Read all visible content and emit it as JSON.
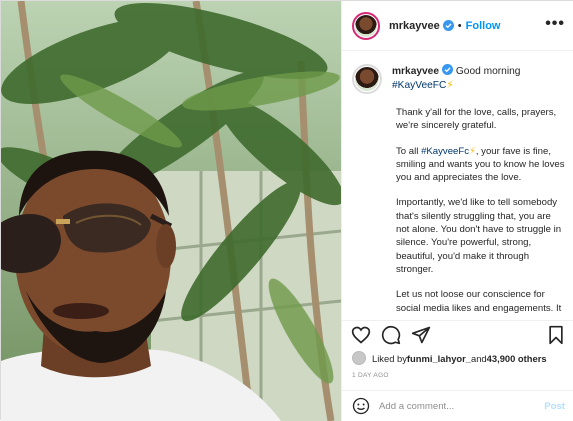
{
  "post": {
    "username": "mrkayvee",
    "dot": "•",
    "follow_label": "Follow",
    "more_label": "•••",
    "caption": {
      "username": "mrkayvee",
      "first_line": "Good morning",
      "first_tag": "#KayVeeFC",
      "first_emoji": "⚡",
      "paragraphs": {
        "p1": "Thank y'all for the love, calls, prayers, we're sincerely grateful.",
        "p2_pre": "To all ",
        "p2_tag": "#KayveeFc",
        "p2_emoji": "⚡",
        "p2_post": ", your fave is fine, smiling and wants you to know he loves you and appreciates the love.",
        "p3": "Importantly, we'd like to tell somebody that's silently struggling that, you are not alone. You don't have to struggle in silence. You're powerful, strong, beautiful, you'd make it through stronger.",
        "p4": "Let us not loose our conscience for social media likes and engagements. It"
      }
    },
    "likes": {
      "prefix": "Liked by ",
      "user": "funmi_lahyor_",
      "middle": " and ",
      "count": "43,900 others"
    },
    "time_ago": "1 DAY AGO",
    "comment": {
      "placeholder": "Add a comment...",
      "post_label": "Post"
    },
    "icons": {
      "like": "heart-icon",
      "comment": "comment-icon",
      "share": "share-icon",
      "save": "bookmark-icon",
      "emoji": "smiley-icon",
      "verified": "verified-badge-icon"
    },
    "colors": {
      "link": "#0095f6",
      "hashtag": "#00376b",
      "muted": "#8e8e8e",
      "verified": "#3897f0"
    }
  }
}
